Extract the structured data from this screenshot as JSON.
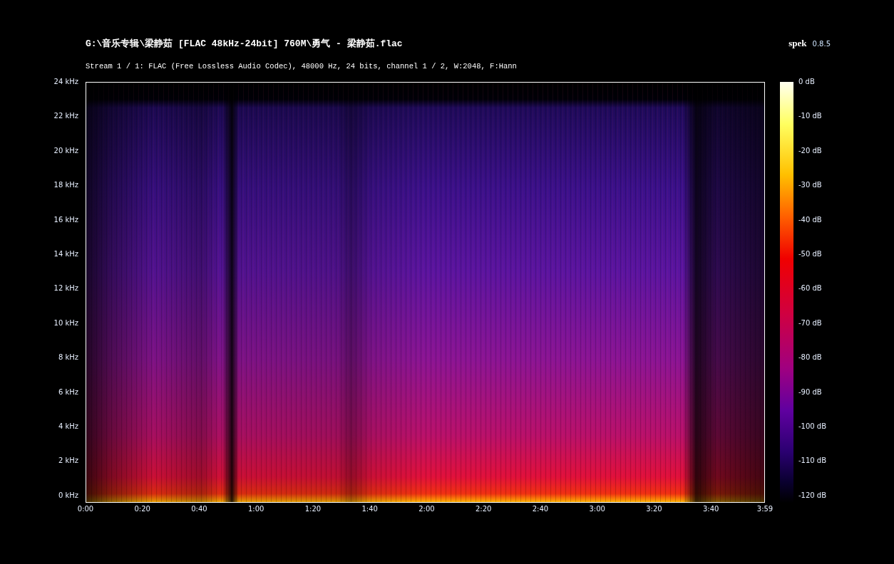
{
  "title": "G:\\音乐专辑\\梁静茹 [FLAC 48kHz-24bit] 760M\\勇气 - 梁静茹.flac",
  "app": {
    "name": "spek",
    "version": "0.8.5"
  },
  "stream_info": "Stream 1 / 1: FLAC (Free Lossless Audio Codec), 48000 Hz, 24 bits, channel 1 / 2, W:2048, F:Hann",
  "y_axis": [
    "24 kHz",
    "22 kHz",
    "20 kHz",
    "18 kHz",
    "16 kHz",
    "14 kHz",
    "12 kHz",
    "10 kHz",
    "8 kHz",
    "6 kHz",
    "4 kHz",
    "2 kHz",
    "0 kHz"
  ],
  "x_axis": [
    "0:00",
    "0:20",
    "0:40",
    "1:00",
    "1:20",
    "1:40",
    "2:00",
    "2:20",
    "2:40",
    "3:00",
    "3:20",
    "3:40",
    "3:59"
  ],
  "colorbar": [
    "0 dB",
    "-10 dB",
    "-20 dB",
    "-30 dB",
    "-40 dB",
    "-50 dB",
    "-60 dB",
    "-70 dB",
    "-80 dB",
    "-90 dB",
    "-100 dB",
    "-110 dB",
    "-120 dB"
  ]
}
